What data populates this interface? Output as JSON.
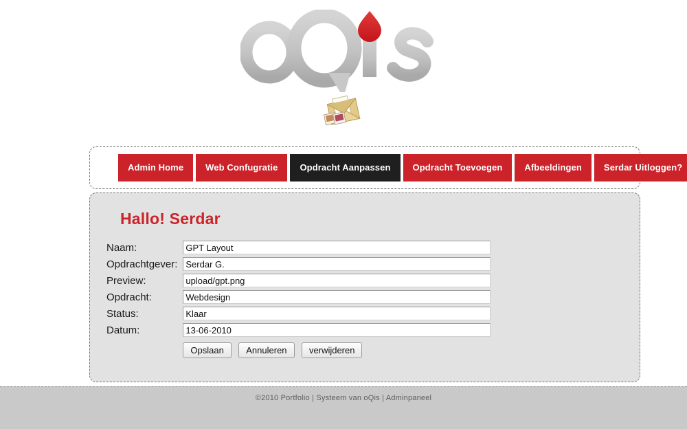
{
  "branding": {
    "logo_text": "oQis",
    "logo_gray": "#bfbfbf",
    "logo_accent": "#d8232a",
    "mail_icon": "envelope-photos-icon"
  },
  "nav": {
    "items": [
      {
        "label": "Admin Home",
        "active": false
      },
      {
        "label": "Web Confugratie",
        "active": false
      },
      {
        "label": "Opdracht Aanpassen",
        "active": true
      },
      {
        "label": "Opdracht Toevoegen",
        "active": false
      },
      {
        "label": "Afbeeldingen",
        "active": false
      },
      {
        "label": "Serdar Uitloggen?",
        "active": false
      }
    ],
    "accent_color": "#cc2229",
    "active_color": "#1f1f1f"
  },
  "content": {
    "greeting": "Hallo! Serdar",
    "greeting_color": "#cc2229",
    "fields": [
      {
        "label": "Naam:",
        "value": "GPT Layout"
      },
      {
        "label": "Opdrachtgever:",
        "value": "Serdar G."
      },
      {
        "label": "Preview:",
        "value": "upload/gpt.png"
      },
      {
        "label": "Opdracht:",
        "value": "Webdesign"
      },
      {
        "label": "Status:",
        "value": "Klaar"
      },
      {
        "label": "Datum:",
        "value": "13-06-2010"
      }
    ],
    "buttons": [
      {
        "label": "Opslaan"
      },
      {
        "label": "Annuleren"
      },
      {
        "label": "verwijderen"
      }
    ]
  },
  "footer": {
    "text": "©2010 Portfolio | Systeem van oQis | Adminpaneel"
  }
}
